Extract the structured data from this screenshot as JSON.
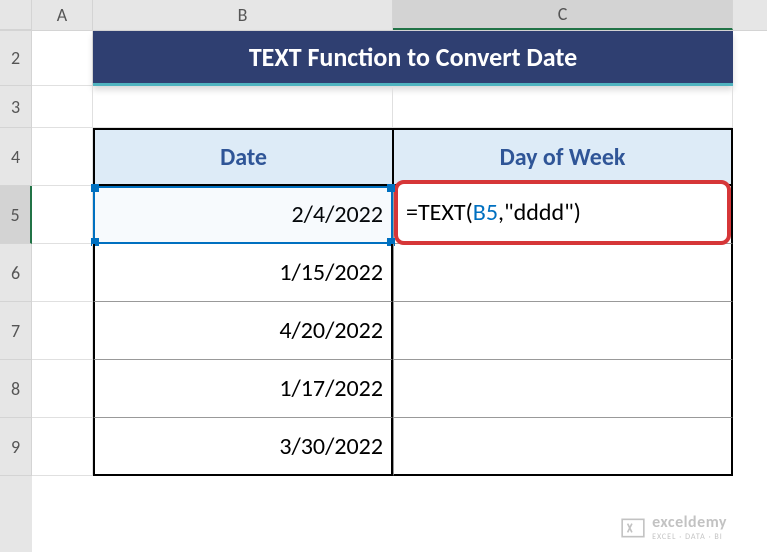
{
  "columns": {
    "A": "A",
    "B": "B",
    "C": "C"
  },
  "rows": {
    "r2": "2",
    "r3": "3",
    "r4": "4",
    "r5": "5",
    "r6": "6",
    "r7": "7",
    "r8": "8",
    "r9": "9"
  },
  "title": "TEXT Function to Convert Date",
  "headers": {
    "date": "Date",
    "day": "Day of Week"
  },
  "dates": [
    "2/4/2022",
    "1/15/2022",
    "4/20/2022",
    "1/17/2022",
    "3/30/2022"
  ],
  "formula": {
    "prefix": "=TEXT(",
    "ref": "B5",
    "suffix": ",\"dddd\")"
  },
  "watermark": {
    "main": "exceldemy",
    "sub": "EXCEL · DATA · BI"
  },
  "row_heights": {
    "r2": 55,
    "r3": 42,
    "r4": 58,
    "r5": 58,
    "r6": 58,
    "r7": 58,
    "r8": 58,
    "r9": 58
  }
}
